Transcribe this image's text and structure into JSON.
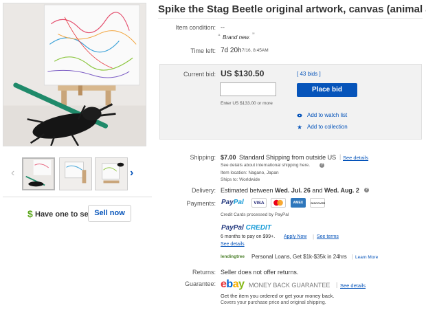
{
  "title": "Spike the Stag Beetle original artwork, canvas (animal art)",
  "condition": {
    "label": "Item condition:",
    "value": "--",
    "quote": "Brand new."
  },
  "time_left": {
    "label": "Time left:",
    "value": "7d 20h",
    "date": "7/16, 8:45AM"
  },
  "bid": {
    "label": "Current bid:",
    "amount": "US $130.50",
    "bids": "[ 43 bids ]",
    "hint": "Enter US $133.00 or more",
    "button": "Place bid",
    "watch": "Add to watch list",
    "collection": "Add to collection"
  },
  "shipping": {
    "label": "Shipping:",
    "cost": "$7.00",
    "desc": "Standard Shipping from outside US",
    "details_link": "See details",
    "intl_note": "See details about international shipping here.",
    "location": "Item location:  Nagano, Japan",
    "ships_to": "Ships to:  Worldwide"
  },
  "delivery": {
    "label": "Delivery:",
    "prefix": "Estimated between ",
    "start": "Wed. Jul. 26",
    "mid": " and ",
    "end": "Wed. Aug. 2"
  },
  "payments": {
    "label": "Payments:",
    "paypal_a": "Pay",
    "paypal_b": "Pal",
    "cards": [
      "VISA",
      "MC",
      "AMEX",
      "DISCOVER"
    ],
    "processed": "Credit Cards processed by PayPal",
    "credit_a": "PayPal",
    "credit_b": " CREDIT",
    "credit_terms": "6 months to pay on $99+.",
    "apply": "Apply Now",
    "terms": "See terms",
    "credit_details": "See details",
    "lending_logo": "lendingtree",
    "lending_text": "Personal Loans, Get $1k-$35k in 24hrs",
    "learn": "Learn More"
  },
  "returns": {
    "label": "Returns:",
    "value": "Seller does not offer returns."
  },
  "guarantee": {
    "label": "Guarantee:",
    "logo": [
      "e",
      "b",
      "a",
      "y"
    ],
    "mbg": "MONEY BACK GUARANTEE",
    "details": "See details",
    "line1": "Get the item you ordered or get your money back.",
    "line2": "Covers your purchase price and original shipping."
  },
  "sell": {
    "dollar": "$",
    "text": "Have one to sell?",
    "button": "Sell now"
  },
  "arrows": {
    "left": "‹",
    "right": "›"
  },
  "colors": {
    "accent": "#0654ba",
    "sell_green": "#5ba71b",
    "bidbox": "#f2f2f2"
  }
}
